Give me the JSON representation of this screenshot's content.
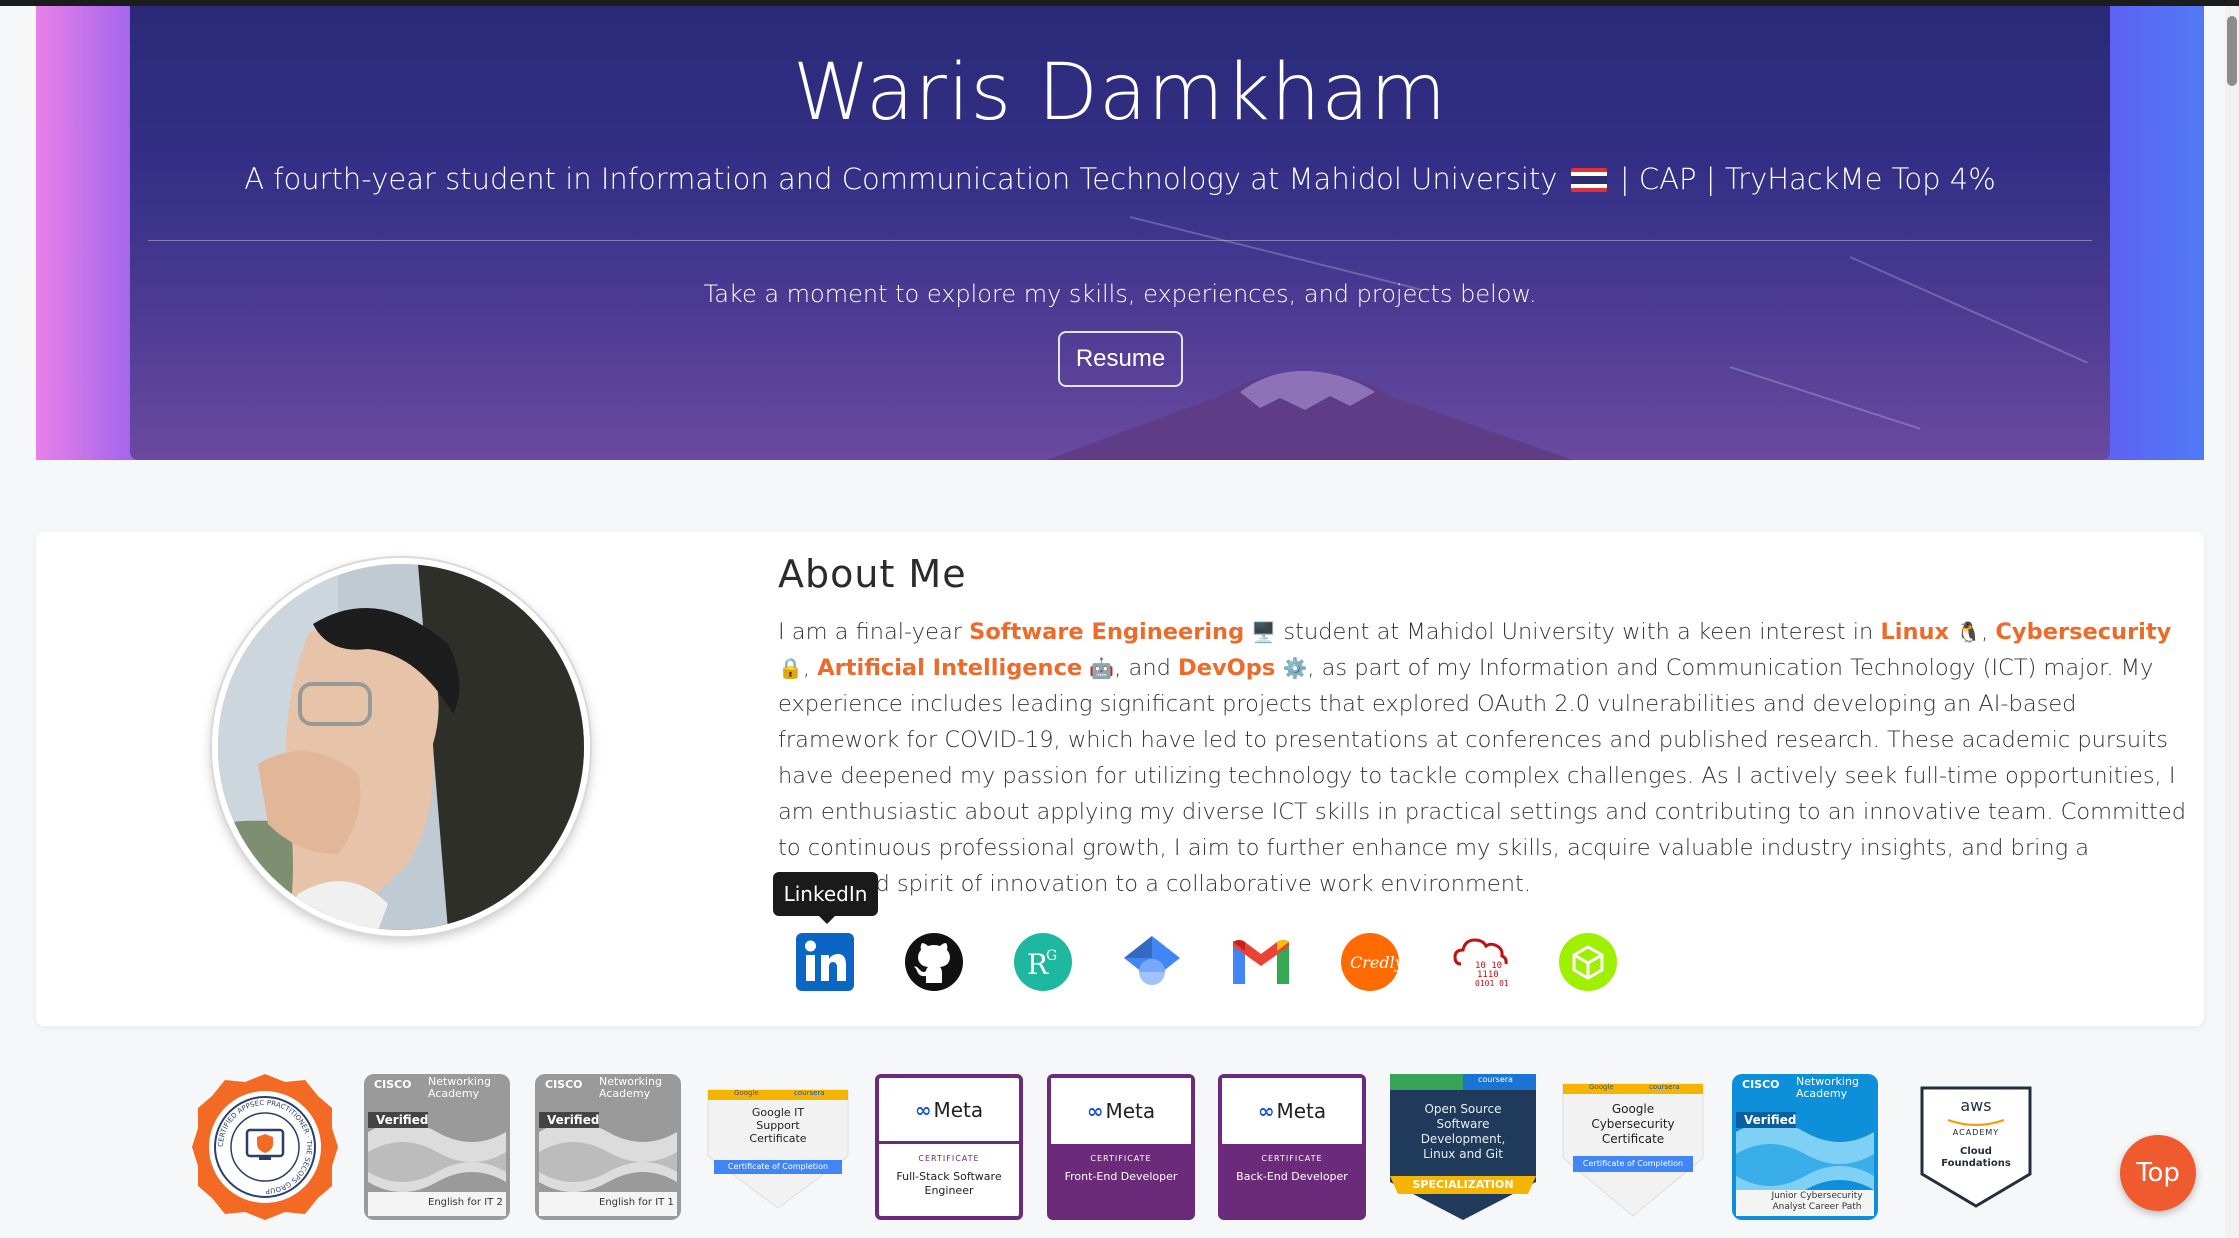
{
  "hero": {
    "title": "Waris Damkham",
    "subtitle_pre": "A fourth-year student in Information and Communication Technology at Mahidol University",
    "subtitle_post": "| CAP | TryHackMe Top 4%",
    "cta": "Take a moment to explore my skills, experiences, and projects below.",
    "resume_label": "Resume"
  },
  "about": {
    "title": "About Me",
    "p1": "I am a final-year ",
    "hl_se": "Software Engineering",
    "p2": " student at Mahidol University with a keen interest in ",
    "hl_linux": "Linux",
    "p3": ", ",
    "hl_cyber": "Cybersecurity",
    "p4": ", ",
    "hl_ai": "Artificial Intelligence",
    "p5": ", and ",
    "hl_devops": "DevOps",
    "p6": ", as part of my Information and Communication Technology (ICT) major. My experience includes leading significant projects that explored OAuth 2.0 vulnerabilities and developing an AI-based framework for COVID-19, which have led to presentations at conferences and published research. These academic pursuits have deepened my passion for utilizing technology to tackle complex challenges. As I actively seek full-time opportunities, I am enthusiastic about applying my diverse ICT skills in practical settings and contributing to an innovative team. Committed to continuous professional growth, I aim to further enhance my skills, acquire valuable industry insights, and bring a dedicated spirit of innovation to a collaborative work environment.",
    "tooltip": "LinkedIn"
  },
  "social_icons": [
    "linkedin-icon",
    "github-icon",
    "researchgate-icon",
    "google-scholar-icon",
    "gmail-icon",
    "credly-icon",
    "tryhackme-icon",
    "hackthebox-icon"
  ],
  "badges": {
    "cisco_brand": "Networking Academy",
    "cisco_logo": "CISCO",
    "verified": "Verified",
    "english2": "English for IT 2",
    "english1": "English for IT 1",
    "google_it": "Google IT Support Certificate",
    "google_cyber": "Google Cybersecurity Certificate",
    "cert_completion": "Certificate of Completion",
    "meta": "Meta",
    "certificate": "CERTIFICATE",
    "meta1": "Full-Stack Software Engineer",
    "meta2": "Front-End Developer",
    "meta3": "Back-End Developer",
    "oss": "Open Source Software Development, Linux and Git",
    "specialization": "SPECIALIZATION",
    "cisco_junior": "Junior Cybersecurity Analyst Career Path",
    "aws_logo": "aws",
    "aws_academy": "ACADEMY",
    "aws_cloud": "Cloud Foundations",
    "secops_ring": "CERTIFIED APPSEC PRACTITIONER · THE SECOPS GROUP",
    "google_small": "Google",
    "coursera_small": "coursera"
  },
  "top_label": "Top",
  "colors": {
    "accent": "#ee6a28",
    "hero_dark": "#2a2a78",
    "top_button": "#ef5b2e"
  }
}
